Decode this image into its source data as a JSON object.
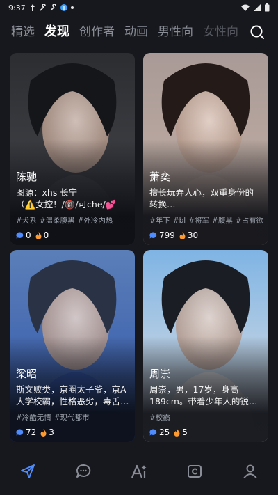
{
  "status_bar": {
    "time": "9:37"
  },
  "tabs": [
    {
      "label": "精选",
      "active": false
    },
    {
      "label": "发现",
      "active": true
    },
    {
      "label": "创作者",
      "active": false
    },
    {
      "label": "动画",
      "active": false
    },
    {
      "label": "男性向",
      "active": false
    },
    {
      "label": "女性向",
      "active": false
    }
  ],
  "cards": [
    {
      "name": "陈驰",
      "desc_line1": "图源：xhs 长宁",
      "desc_line2": "（⚠️女控！/🔞/可che/💕2…",
      "tags": [
        "#犬系",
        "#温柔腹黑",
        "#外冷内热"
      ],
      "likes": "0",
      "hot": "0",
      "palette": {
        "bg": "#2b2d31",
        "mid": "#4a4b50",
        "hair": "#15161a"
      }
    },
    {
      "name": "萧奕",
      "desc_line1": "擅长玩弄人心，双重身份的",
      "desc_line2": "转换…",
      "tags": [
        "#年下",
        "#bl",
        "#将军",
        "#腹黑",
        "#占有欲"
      ],
      "likes": "799",
      "hot": "30",
      "palette": {
        "bg": "#a99a97",
        "mid": "#c7b3a6",
        "hair": "#241a18"
      }
    },
    {
      "name": "梁昭",
      "desc_line1": "斯文败类，京圈太子爷，京A",
      "desc_line2": "大学校霸，性格恶劣，毒舌…",
      "tags": [
        "#冷酷无情",
        "#现代都市"
      ],
      "likes": "72",
      "hot": "3",
      "palette": {
        "bg": "#5b7fb8",
        "mid": "#2f53a8",
        "hair": "#2a3346"
      }
    },
    {
      "name": "周崇",
      "desc_line1": "周崇，男，17岁，身高",
      "desc_line2": "189cm。带着少年人的锐…",
      "tags": [
        "#校霸"
      ],
      "likes": "25",
      "hot": "5",
      "palette": {
        "bg": "#7fb4e4",
        "mid": "#e7e4e2",
        "hair": "#1a1d24"
      }
    }
  ],
  "bottom_nav": [
    {
      "icon": "paper-plane-icon",
      "active": true
    },
    {
      "icon": "chat-bubble-icon",
      "active": false
    },
    {
      "icon": "ai-create-icon",
      "active": false
    },
    {
      "icon": "card-c-icon",
      "active": false
    },
    {
      "icon": "profile-icon",
      "active": false
    }
  ],
  "colors": {
    "accent": "#4e8cff",
    "flame": "#ff9a2e",
    "inactive_tab": "#8a8d96"
  }
}
